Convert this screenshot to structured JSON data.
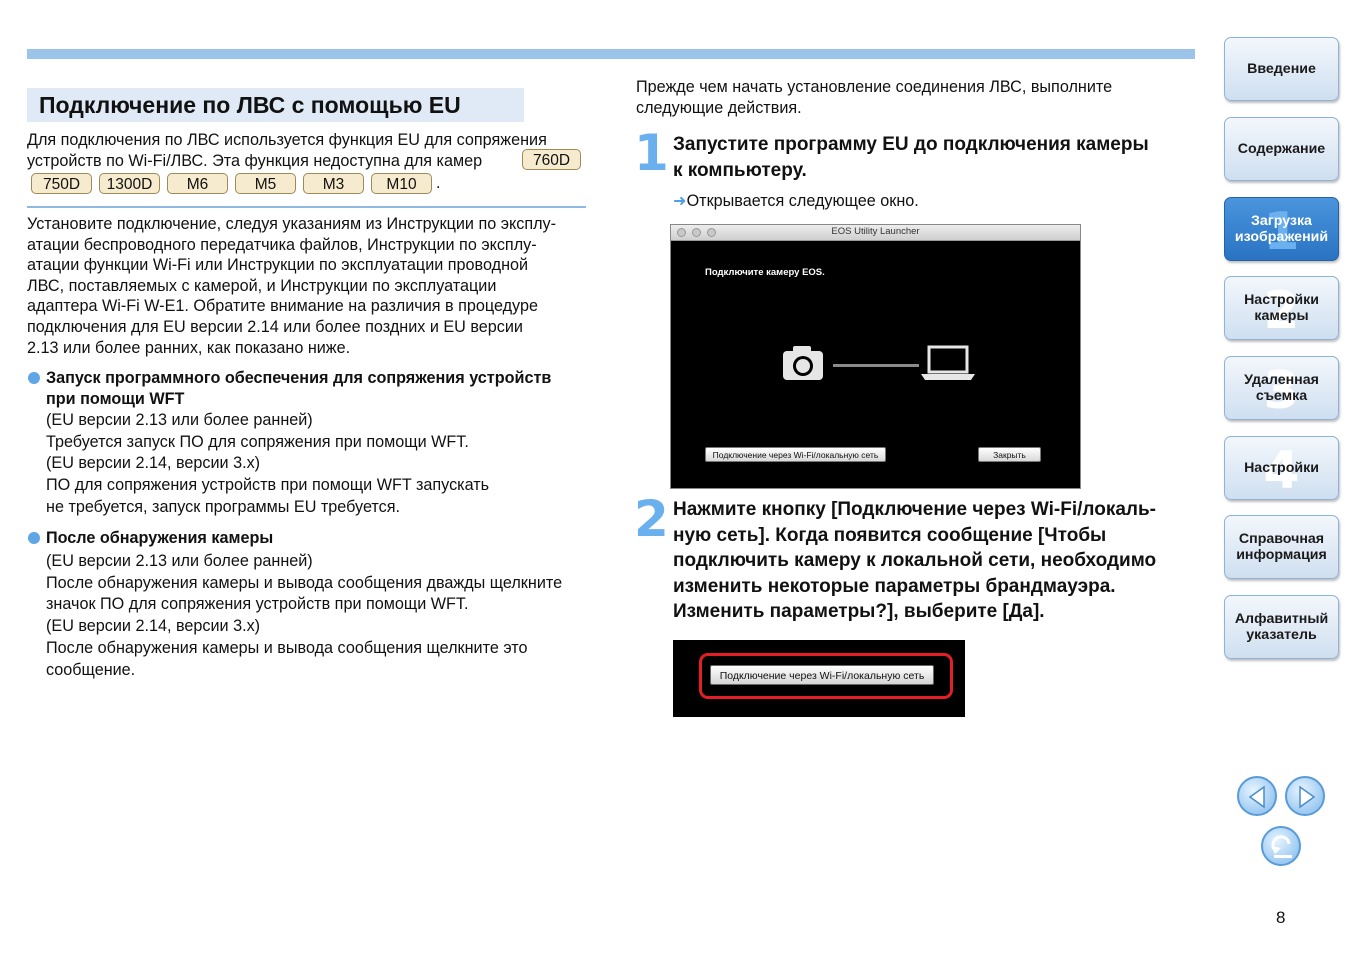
{
  "left": {
    "title": "Подключение по ЛВС с помощью EU",
    "intro_line1": "Для подключения по ЛВС используется функция EU для сопряжения",
    "intro_line2": "устройств по Wi-Fi/ЛВС. Эта функция недоступна для камер",
    "intro_end": ".",
    "models": [
      "760D",
      "750D",
      "1300D",
      "M6",
      "M5",
      "M3",
      "M10"
    ],
    "para2": [
      "Установите подключение, следуя указаниям из Инструкции по эксплу-",
      "атации беспроводного передатчика файлов, Инструкции по эксплу-",
      "атации функции Wi-Fi или Инструкции по эксплуатации проводной",
      "ЛВС, поставляемых с камерой, и Инструкции по эксплуатации",
      "адаптера Wi-Fi W-E1. Обратите внимание на различия в процедуре",
      "подключения для EU версии 2.14 или более поздних и EU версии",
      "2.13 или более ранних, как показано ниже."
    ],
    "bullet1": {
      "head": [
        "Запуск программного обеспечения для сопряжения устройств",
        "при помощи WFT"
      ],
      "body": [
        "(EU версии 2.13 или более ранней)",
        "Требуется запуск ПО для сопряжения при помощи WFT.",
        "(EU версии 2.14, версии 3.x)",
        "ПО для сопряжения устройств при помощи WFT запускать",
        "не требуется, запуск программы EU требуется."
      ]
    },
    "bullet2": {
      "head": [
        "После обнаружения камеры"
      ],
      "body": [
        "(EU версии 2.13 или более ранней)",
        "После обнаружения камеры и вывода сообщения дважды щелкните",
        "значок ПО для сопряжения устройств при помощи WFT.",
        "(EU версии 2.14, версии 3.x)",
        "После обнаружения камеры и вывода сообщения щелкните это",
        "сообщение."
      ]
    }
  },
  "right": {
    "intro": [
      "Прежде чем начать установление соединения ЛВС, выполните",
      "следующие действия."
    ],
    "step1": {
      "num": "1",
      "head": [
        "Запустите программу EU до подключения камеры",
        "к компьютеру."
      ],
      "arrow": "➜",
      "result": "Открывается следующее окно."
    },
    "window": {
      "title": "EOS Utility Launcher",
      "message": "Подключите камеру EOS.",
      "wifi_button": "Подключение через Wi-Fi/локальную сеть",
      "close_button": "Закрыть"
    },
    "step2": {
      "num": "2",
      "head": [
        "Нажмите кнопку [Подключение через Wi-Fi/локаль-",
        "ную сеть]. Когда появится сообщение [Чтобы",
        "подключить камеру к локальной сети, необходимо",
        "изменить некоторые параметры брандмауэра.",
        "Изменить параметры?], выберите [Да]."
      ]
    },
    "crop_button": "Подключение через Wi-Fi/локальную сеть"
  },
  "nav": [
    {
      "label": "Введение",
      "num": ""
    },
    {
      "label": "Содержание",
      "num": ""
    },
    {
      "label": "Загрузка\nизображений",
      "num": "1",
      "active": true
    },
    {
      "label": "Настройки\nкамеры",
      "num": "2"
    },
    {
      "label": "Удаленная\nсъемка",
      "num": "3"
    },
    {
      "label": "Настройки",
      "num": "4"
    },
    {
      "label": "Справочная\nинформация",
      "num": ""
    },
    {
      "label": "Алфавитный\nуказатель",
      "num": ""
    }
  ],
  "page_number": "8",
  "colors": {
    "accent": "#9cc3ea",
    "step_number": "#6ab0ee",
    "nav_active": "#2a73c2",
    "highlight_ring": "#e41e25",
    "tag_fill": "#f6ebcf"
  }
}
